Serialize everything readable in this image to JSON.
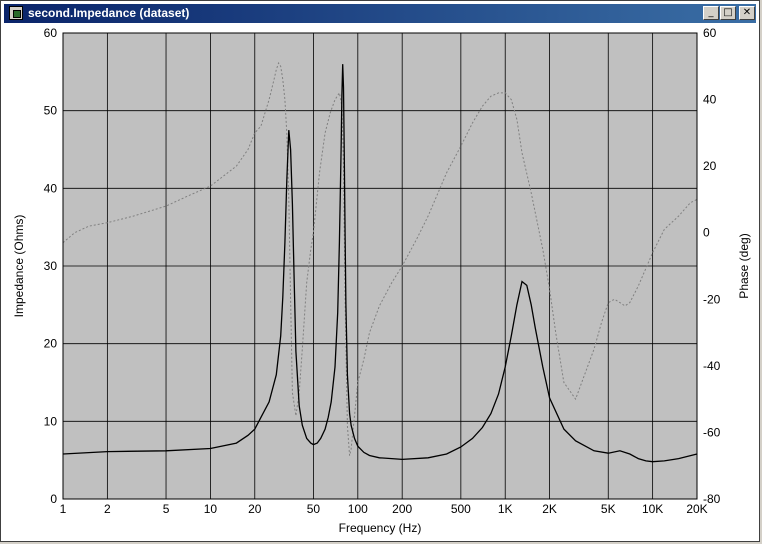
{
  "window": {
    "title": "second.Impedance (dataset)",
    "icons": [
      "app-icon",
      "minimize-icon",
      "maximize-icon",
      "close-icon"
    ]
  },
  "chart_data": {
    "type": "line",
    "xscale": "log",
    "xlim": [
      1,
      20000
    ],
    "xticks": [
      1,
      2,
      5,
      10,
      20,
      50,
      100,
      200,
      500,
      1000,
      2000,
      5000,
      10000,
      20000
    ],
    "xtick_labels": [
      "1",
      "2",
      "5",
      "10",
      "20",
      "50",
      "100",
      "200",
      "500",
      "1K",
      "2K",
      "5K",
      "10K",
      "20K"
    ],
    "xlabel": "Frequency (Hz)",
    "ylabel": "Impedance (Ohms)",
    "ylim": [
      0,
      60
    ],
    "yticks": [
      0,
      10,
      20,
      30,
      40,
      50,
      60
    ],
    "ytick_labels": [
      "0",
      "10",
      "20",
      "30",
      "40",
      "50",
      "60"
    ],
    "y2label": "Phase (deg)",
    "y2lim": [
      -80,
      60
    ],
    "y2ticks": [
      -80,
      -60,
      -40,
      -20,
      0,
      20,
      40,
      60
    ],
    "y2tick_labels": [
      "-80",
      "-60",
      "-40",
      "-20",
      "0",
      "20",
      "40",
      "60"
    ],
    "grid": true,
    "background": "#c0c0c0",
    "series": [
      {
        "axis": "left",
        "style": "solid",
        "color": "#000000",
        "x": [
          1,
          2,
          5,
          10,
          15,
          18,
          20,
          22,
          25,
          28,
          30,
          31,
          32,
          33,
          34,
          35,
          36,
          37,
          38,
          40,
          42,
          45,
          48,
          50,
          53,
          56,
          60,
          63,
          66,
          70,
          73,
          75,
          77,
          78,
          79,
          80,
          81,
          82,
          83,
          85,
          88,
          90,
          95,
          100,
          110,
          120,
          140,
          170,
          200,
          300,
          400,
          500,
          600,
          700,
          800,
          900,
          1000,
          1100,
          1200,
          1300,
          1400,
          1500,
          1600,
          1800,
          2000,
          2500,
          3000,
          4000,
          5000,
          6000,
          7000,
          8000,
          9000,
          10000,
          12000,
          15000,
          20000
        ],
        "y": [
          5.8,
          6.1,
          6.2,
          6.5,
          7.2,
          8.2,
          9.0,
          10.5,
          12.5,
          16,
          21,
          26,
          33,
          41,
          47.5,
          45,
          38,
          28,
          19,
          12,
          9.5,
          7.8,
          7.2,
          7.0,
          7.2,
          7.8,
          9,
          10.5,
          12.5,
          17,
          24,
          33,
          45,
          52,
          56,
          53,
          44,
          34,
          25,
          16,
          11,
          9.5,
          7.8,
          6.8,
          6.0,
          5.6,
          5.3,
          5.2,
          5.1,
          5.3,
          5.8,
          6.7,
          7.8,
          9.2,
          11,
          13.5,
          17,
          21,
          25,
          28,
          27.5,
          25,
          22,
          17,
          13,
          9,
          7.5,
          6.2,
          5.9,
          6.2,
          5.8,
          5.2,
          4.9,
          4.8,
          4.9,
          5.2,
          5.8
        ]
      },
      {
        "axis": "right",
        "style": "dotted",
        "color": "#808080",
        "x": [
          1,
          1.2,
          1.5,
          2,
          3,
          5,
          7,
          10,
          15,
          18,
          20,
          22,
          25,
          27,
          28,
          29,
          30,
          31,
          32,
          33,
          34,
          35,
          36,
          38,
          40,
          42,
          45,
          48,
          50,
          55,
          60,
          65,
          70,
          75,
          78,
          80,
          82,
          85,
          88,
          90,
          95,
          100,
          110,
          120,
          140,
          170,
          200,
          250,
          300,
          400,
          500,
          600,
          700,
          800,
          900,
          1000,
          1100,
          1200,
          1300,
          1500,
          1800,
          2000,
          2200,
          2500,
          3000,
          3500,
          4000,
          4500,
          5000,
          5500,
          6000,
          6500,
          7000,
          8000,
          10000,
          12000,
          15000,
          18000,
          20000
        ],
        "y": [
          -3,
          0,
          2,
          3,
          5,
          8,
          11,
          14,
          20,
          25,
          30,
          32,
          40,
          46,
          49,
          51,
          50,
          46,
          40,
          30,
          10,
          -20,
          -48,
          -55,
          -48,
          -35,
          -15,
          -5,
          0,
          18,
          30,
          36,
          40,
          42,
          38,
          20,
          -20,
          -58,
          -67,
          -65,
          -55,
          -45,
          -38,
          -30,
          -22,
          -15,
          -10,
          -2,
          5,
          18,
          26,
          33,
          38,
          41,
          42,
          42,
          40,
          34,
          24,
          12,
          -5,
          -17,
          -30,
          -45,
          -50,
          -42,
          -35,
          -27,
          -21,
          -20,
          -21,
          -22,
          -21,
          -16,
          -6,
          1,
          5,
          9,
          10
        ]
      }
    ]
  }
}
